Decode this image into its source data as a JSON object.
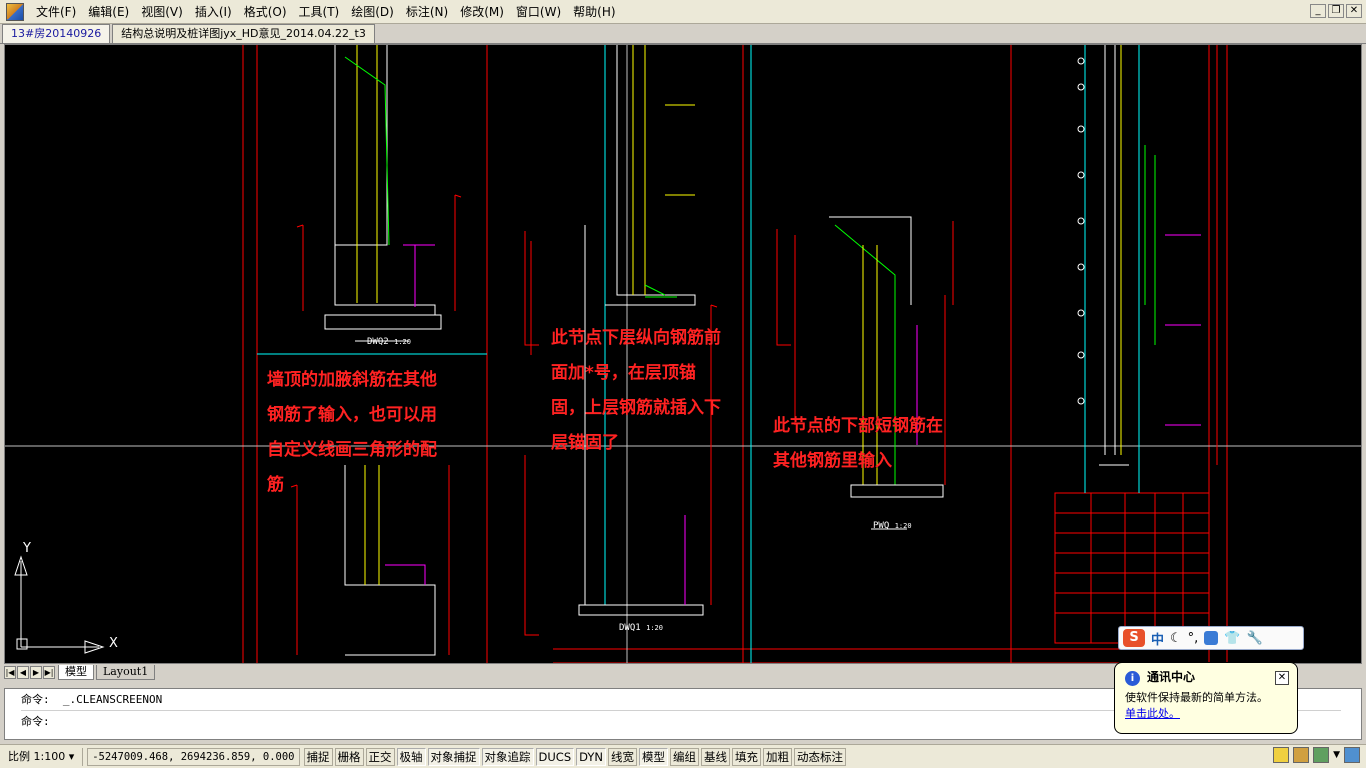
{
  "menubar": {
    "items": [
      "文件(F)",
      "编辑(E)",
      "视图(V)",
      "插入(I)",
      "格式(O)",
      "工具(T)",
      "绘图(D)",
      "标注(N)",
      "修改(M)",
      "窗口(W)",
      "帮助(H)"
    ]
  },
  "doc_tabs": [
    "13#房20140926",
    "结构总说明及桩详图jyx_HD意见_2014.04.22_t3"
  ],
  "annotations": [
    "墙顶的加腋斜筋在其他",
    "钢筋了输入，也可以用",
    "自定义线画三角形的配",
    "筋",
    "此节点下层纵向钢筋前",
    "面加*号，在层顶锚",
    "固，上层钢筋就插入下",
    "层锚固了",
    "此节点的下部短钢筋在",
    "其他钢筋里输入"
  ],
  "drawing_labels": {
    "dwq2": "DWQ2",
    "dwq1": "DWQ1",
    "pwq": "PWQ",
    "scale_1_20": "1:20"
  },
  "ucs": {
    "y": "Y",
    "x": "X"
  },
  "layout_tabs": [
    "模型",
    "Layout1"
  ],
  "command": {
    "prompt": "命令:",
    "history": "_.CLEANSCREENON",
    "current": ""
  },
  "status": {
    "scale": "比例 1:100 ▾",
    "coords": "-5247009.468, 2694236.859, 0.000",
    "toggles": [
      "捕捉",
      "栅格",
      "正交",
      "极轴",
      "对象捕捉",
      "对象追踪",
      "DUCS",
      "DYN",
      "线宽",
      "模型",
      "编组",
      "基线",
      "填充",
      "加粗",
      "动态标注"
    ],
    "toggles_on": [
      "极轴",
      "对象捕捉",
      "对象追踪",
      "DUCS",
      "DYN",
      "模型"
    ]
  },
  "balloon": {
    "title": "通讯中心",
    "message": "使软件保持最新的简单方法。",
    "link": "单击此处。"
  },
  "ime": {
    "logo": "S",
    "lang": "中"
  },
  "colors": {
    "canvas_bg": "#000000",
    "note_red": "#ff2222",
    "cad_red": "#ff0000",
    "cad_cyan": "#00ffff",
    "cad_yellow": "#ffff00",
    "cad_green": "#00ff00",
    "cad_magenta": "#ff00ff"
  }
}
